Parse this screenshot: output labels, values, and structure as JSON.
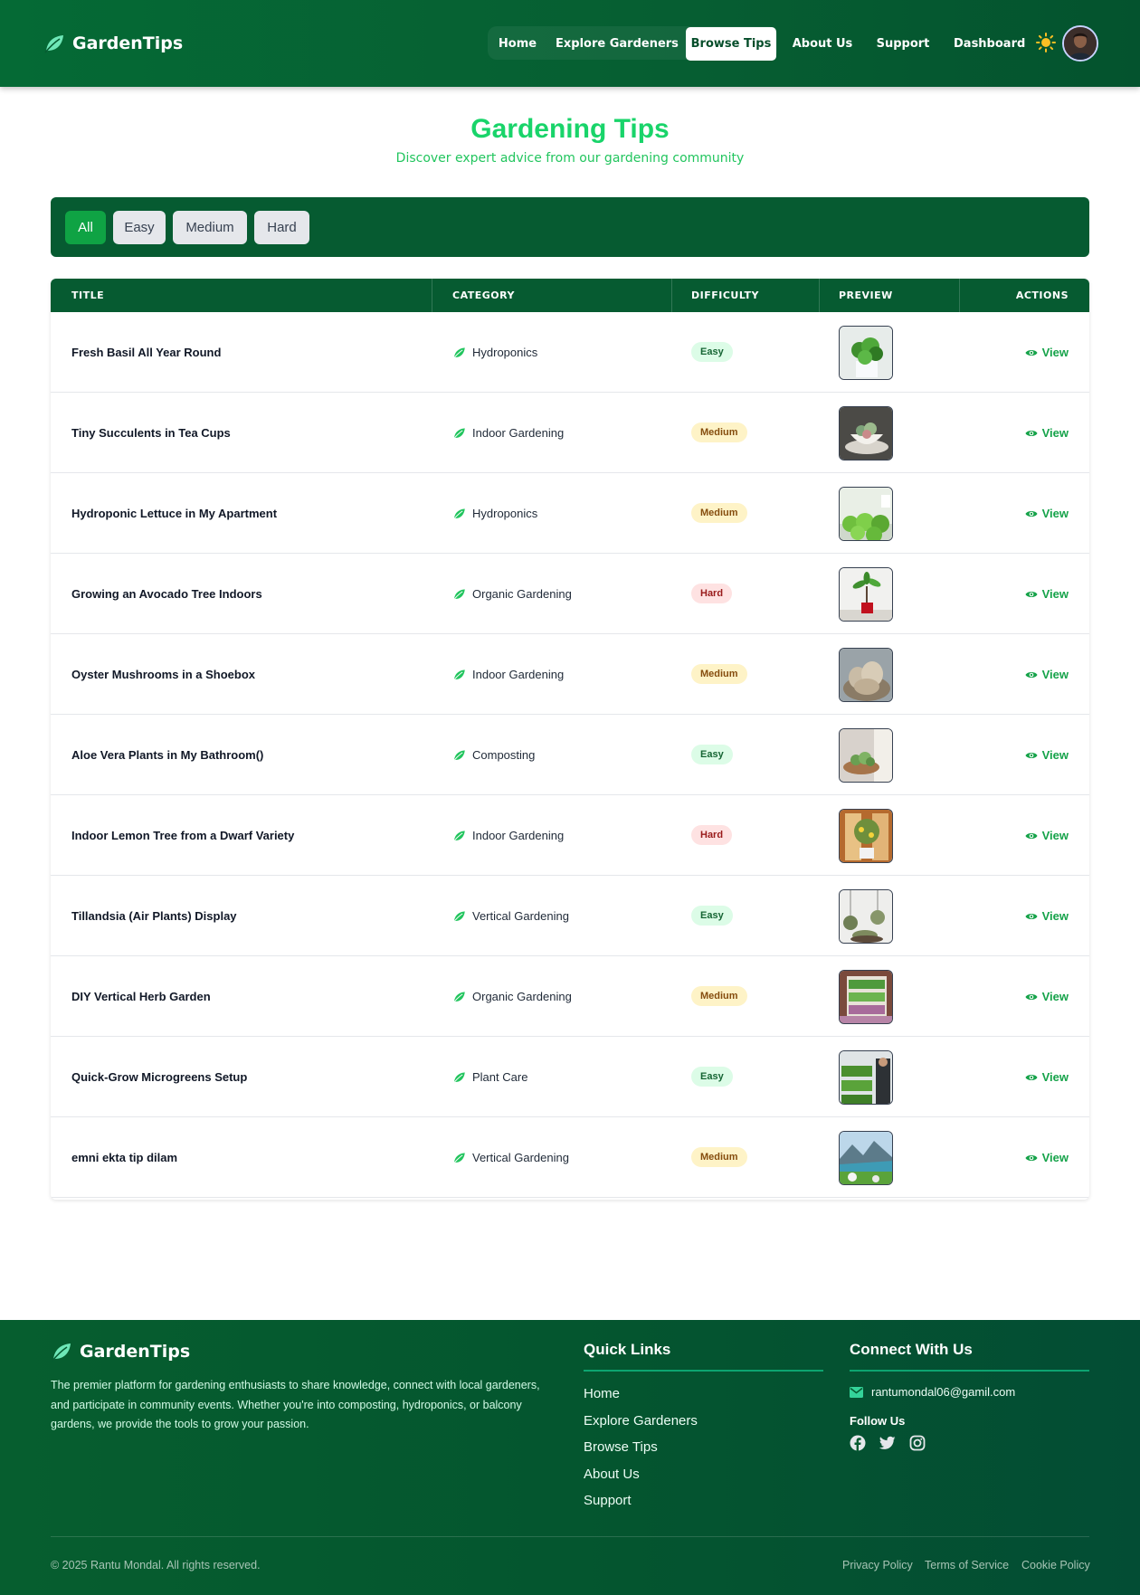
{
  "app": {
    "brand": "GardenTips"
  },
  "nav": {
    "items": [
      {
        "label": "Home"
      },
      {
        "label": "Explore Gardeners"
      },
      {
        "label": "Browse Tips"
      },
      {
        "label": "About Us"
      },
      {
        "label": "Support"
      },
      {
        "label": "Dashboard"
      }
    ],
    "active_index": 2
  },
  "header": {
    "title": "Gardening Tips",
    "subtitle": "Discover expert advice from our gardening community"
  },
  "filters": {
    "options": [
      "All",
      "Easy",
      "Medium",
      "Hard"
    ],
    "selected": "All"
  },
  "table": {
    "columns": [
      "TITLE",
      "CATEGORY",
      "DIFFICULTY",
      "PREVIEW",
      "ACTIONS"
    ],
    "action_label": "View",
    "rows": [
      {
        "title": "Fresh Basil All Year Round",
        "category": "Hydroponics",
        "difficulty": "Easy",
        "thumb": "basil"
      },
      {
        "title": "Tiny Succulents in Tea Cups",
        "category": "Indoor Gardening",
        "difficulty": "Medium",
        "thumb": "teacup"
      },
      {
        "title": "Hydroponic Lettuce in My Apartment",
        "category": "Hydroponics",
        "difficulty": "Medium",
        "thumb": "lettuce"
      },
      {
        "title": "Growing an Avocado Tree Indoors",
        "category": "Organic Gardening",
        "difficulty": "Hard",
        "thumb": "avocado"
      },
      {
        "title": "Oyster Mushrooms in a Shoebox",
        "category": "Indoor Gardening",
        "difficulty": "Medium",
        "thumb": "mushroom"
      },
      {
        "title": "Aloe Vera Plants in My Bathroom()",
        "category": "Composting",
        "difficulty": "Easy",
        "thumb": "aloe"
      },
      {
        "title": "Indoor Lemon Tree from a Dwarf Variety",
        "category": "Indoor Gardening",
        "difficulty": "Hard",
        "thumb": "lemon"
      },
      {
        "title": "Tillandsia (Air Plants) Display",
        "category": "Vertical Gardening",
        "difficulty": "Easy",
        "thumb": "airplant"
      },
      {
        "title": "DIY Vertical Herb Garden",
        "category": "Organic Gardening",
        "difficulty": "Medium",
        "thumb": "herbs"
      },
      {
        "title": "Quick-Grow Microgreens Setup",
        "category": "Plant Care",
        "difficulty": "Easy",
        "thumb": "microgreens"
      },
      {
        "title": "emni ekta tip dilam",
        "category": "Vertical Gardening",
        "difficulty": "Medium",
        "thumb": "landscape"
      }
    ]
  },
  "footer": {
    "brand": "GardenTips",
    "description": "The premier platform for gardening enthusiasts to share knowledge, connect with local gardeners, and participate in community events. Whether you're into composting, hydroponics, or balcony gardens, we provide the tools to grow your passion.",
    "quick_links_title": "Quick Links",
    "quick_links": [
      "Home",
      "Explore Gardeners",
      "Browse Tips",
      "About Us",
      "Support"
    ],
    "connect_title": "Connect With Us",
    "email": "rantumondal06@gamil.com",
    "follow_title": "Follow Us",
    "social": [
      "facebook-icon",
      "twitter-icon",
      "instagram-icon"
    ],
    "copyright": "© 2025 Rantu Mondal. All rights reserved.",
    "legal_links": [
      "Privacy Policy",
      "Terms of Service",
      "Cookie Policy"
    ]
  },
  "colors": {
    "primary_dark": "#065b31",
    "accent": "#16a34a",
    "title_green": "#19d46a"
  }
}
